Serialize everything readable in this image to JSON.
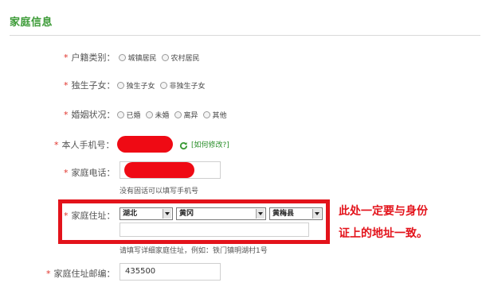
{
  "section": {
    "title": "家庭信息"
  },
  "hukou": {
    "label": "户籍类别：",
    "options": [
      "城镇居民",
      "农村居民"
    ]
  },
  "only_child": {
    "label": "独生子女：",
    "options": [
      "独生子女",
      "非独生子女"
    ]
  },
  "marital": {
    "label": "婚姻状况：",
    "options": [
      "已婚",
      "未婚",
      "离异",
      "其他"
    ]
  },
  "phone": {
    "label": "本人手机号：",
    "refresh_icon": "refresh-icon",
    "modify_link": "[如何修改?]"
  },
  "home_phone": {
    "label": "家庭电话：",
    "hint": "没有固话可以填写手机号"
  },
  "address": {
    "label": "家庭住址：",
    "province": "湖北",
    "city": "黄冈",
    "county": "黄梅县",
    "detail_value": "",
    "hint": "请填写详细家庭住址，例如：铁门镇明湖村1号"
  },
  "postcode": {
    "label": "家庭住址邮编：",
    "value": "435500"
  },
  "annotation": {
    "line1": "此处一定要与身份",
    "line2": "证上的地址一致。"
  },
  "colors": {
    "accent": "#3a9a35",
    "required": "#e0322a",
    "highlight": "#e3131b"
  }
}
